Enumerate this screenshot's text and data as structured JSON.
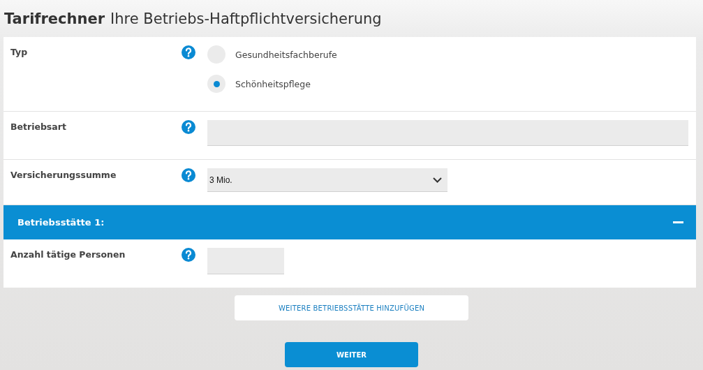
{
  "header": {
    "brand": "Tarifrechner",
    "title": "Ihre Betriebs-Haftpflichtversicherung"
  },
  "fields": [
    {
      "kind": "radio",
      "label": "Typ",
      "options": [
        {
          "label": "Gesundheitsfachberufe",
          "selected": false
        },
        {
          "label": "Schönheitspflege",
          "selected": true
        }
      ]
    },
    {
      "kind": "text",
      "label": "Betriebsart"
    },
    {
      "kind": "select",
      "label": "Versicherungssumme",
      "value": "3 Mio."
    }
  ],
  "sections": [
    {
      "title": "Betriebsstätte 1:",
      "expanded": true,
      "fields": [
        {
          "kind": "short",
          "label": "Anzahl tätige Personen"
        }
      ]
    }
  ],
  "add_button": "WEITERE BETRIEBSSTÄTTE HINZUFÜGEN",
  "next_button": "WEITER"
}
